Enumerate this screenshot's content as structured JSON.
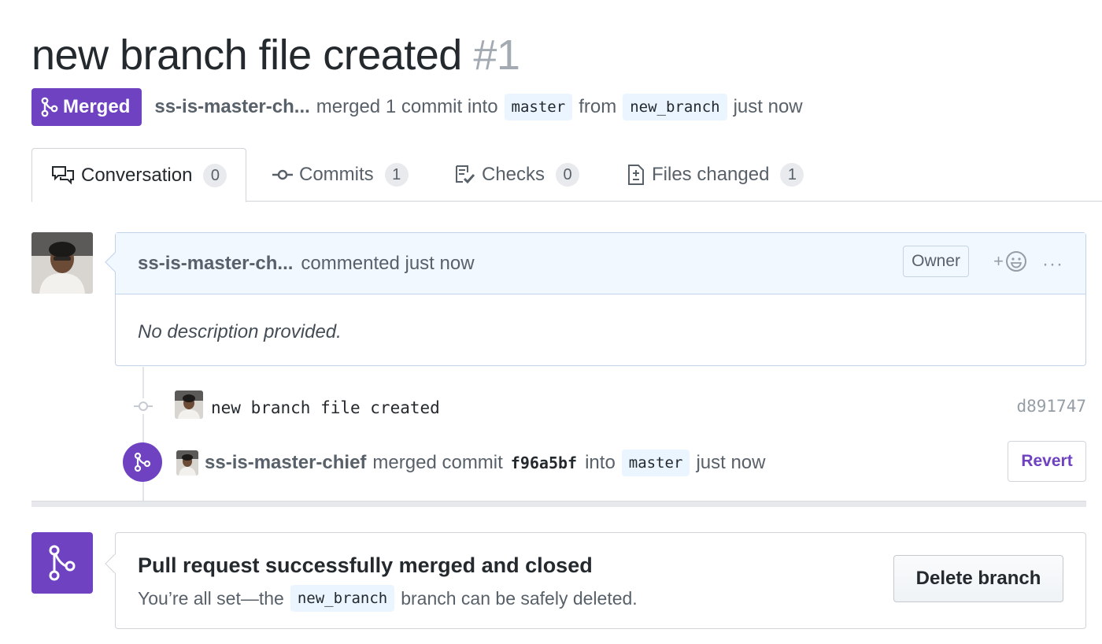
{
  "pr": {
    "title": "new branch file created",
    "number": "#1",
    "status_label": "Merged",
    "author": "ss-is-master-ch...",
    "merge_text": "merged 1 commit into",
    "base_branch": "master",
    "from_text": "from",
    "head_branch": "new_branch",
    "time": "just now"
  },
  "tabs": [
    {
      "label": "Conversation",
      "count": "0",
      "icon": "comment-discussion-icon",
      "selected": true
    },
    {
      "label": "Commits",
      "count": "1",
      "icon": "git-commit-icon",
      "selected": false
    },
    {
      "label": "Checks",
      "count": "0",
      "icon": "checklist-icon",
      "selected": false
    },
    {
      "label": "Files changed",
      "count": "1",
      "icon": "diff-icon",
      "selected": false
    }
  ],
  "comment": {
    "author": "ss-is-master-ch...",
    "action": "commented just now",
    "role_badge": "Owner",
    "reaction_plus": "+",
    "more": "···",
    "body": "No description provided."
  },
  "timeline": {
    "commit": {
      "message": "new branch file created",
      "sha": "d891747"
    },
    "merge_event": {
      "author": "ss-is-master-chief",
      "text_before": "merged commit",
      "sha": "f96a5bf",
      "into": "into",
      "branch": "master",
      "time": "just now",
      "revert_label": "Revert"
    }
  },
  "merge_status": {
    "title": "Pull request successfully merged and closed",
    "sub_before": "You’re all set—the",
    "branch": "new_branch",
    "sub_after": "branch can be safely deleted.",
    "delete_label": "Delete branch"
  },
  "colors": {
    "merged_purple": "#6f42c1",
    "header_blue": "#f1f8ff",
    "border": "#d1d5da"
  }
}
